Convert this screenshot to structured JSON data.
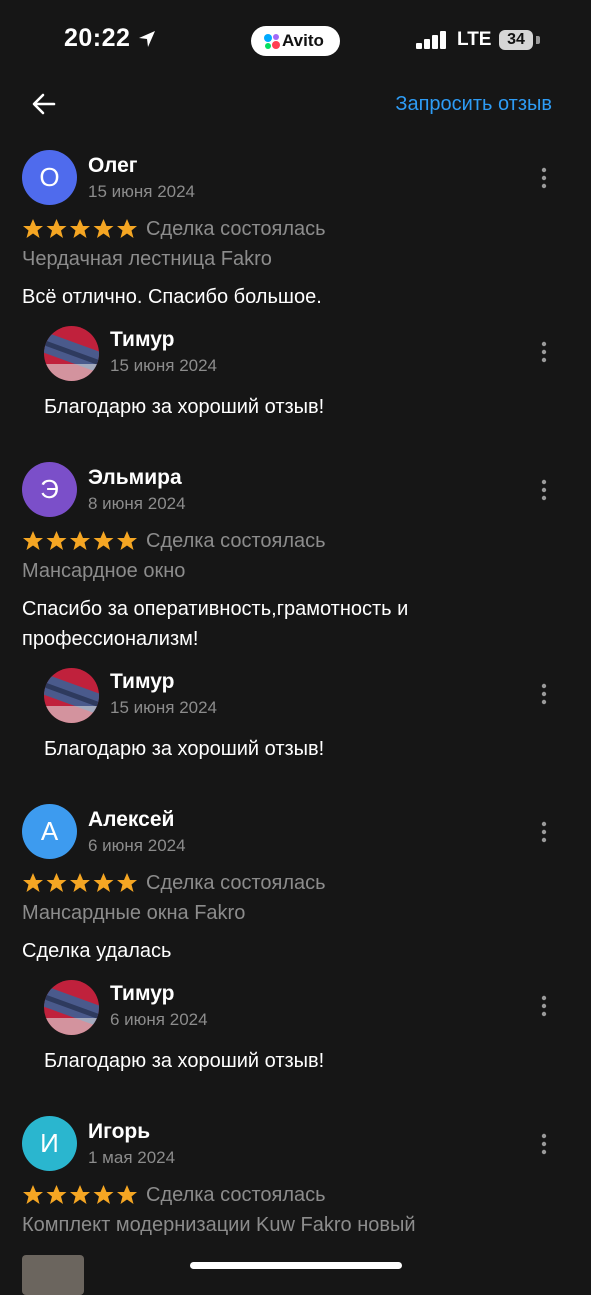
{
  "status_bar": {
    "time": "20:22",
    "app_pill": "Avito",
    "network": "LTE",
    "battery": "34"
  },
  "header": {
    "request_review": "Запросить отзыв",
    "back_icon": "arrow-left-icon"
  },
  "reviews": [
    {
      "initial": "О",
      "avatar_color": "#4f6bed",
      "name": "Олег",
      "date": "15 июня 2024",
      "rating": 5,
      "status": "Сделка состоялась",
      "item": "Чердачная лестница Fakro",
      "text": "Всё отлично.  Спасибо большое.",
      "reply": {
        "name": "Тимур",
        "date": "15 июня 2024",
        "text": "Благодарю за хороший отзыв!"
      }
    },
    {
      "initial": "Э",
      "avatar_color": "#7b4fc9",
      "name": "Эльмира",
      "date": "8 июня 2024",
      "rating": 5,
      "status": "Сделка состоялась",
      "item": "Мансардное окно",
      "text": "Спасибо за оперативность,грамотность и профессионализм!",
      "reply": {
        "name": "Тимур",
        "date": "15 июня 2024",
        "text": "Благодарю за хороший отзыв!"
      }
    },
    {
      "initial": "А",
      "avatar_color": "#3d9bef",
      "name": "Алексей",
      "date": "6 июня 2024",
      "rating": 5,
      "status": "Сделка состоялась",
      "item": "Мансардные окна Fakro",
      "text": "Сделка удалась",
      "reply": {
        "name": "Тимур",
        "date": "6 июня 2024",
        "text": "Благодарю за хороший отзыв!"
      }
    },
    {
      "initial": "И",
      "avatar_color": "#2ab6cf",
      "name": "Игорь",
      "date": "1 мая 2024",
      "rating": 5,
      "status": "Сделка состоялась",
      "item": "Комплект модернизации Kuw Fakro новый",
      "text": "",
      "reply": null
    }
  ],
  "colors": {
    "background": "#161616",
    "accent": "#2e9cf5",
    "star": "#f5a623",
    "secondary_text": "#8c8c8c"
  }
}
